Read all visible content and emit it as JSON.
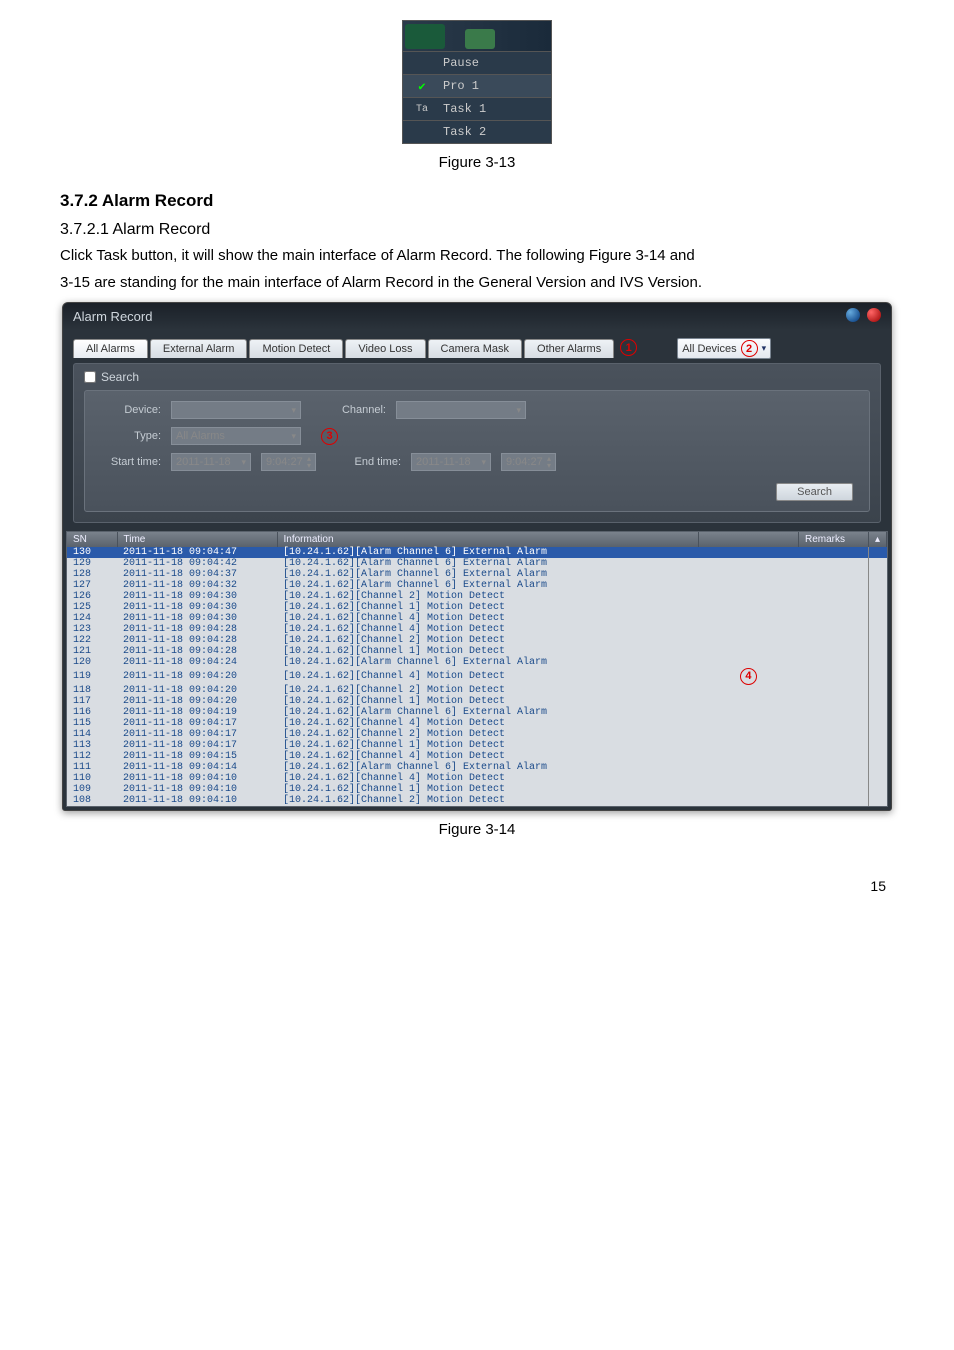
{
  "fig1": {
    "menu": [
      "Pause",
      "Pro 1",
      "Task 1",
      "Task 2"
    ],
    "ta_label": "Ta",
    "caption": "Figure 3-13"
  },
  "section": {
    "h3": "3.7.2  Alarm Record",
    "h4": "3.7.2.1  Alarm Record",
    "p1": "Click Task button, it will show the main interface of Alarm Record. The following Figure 3-14 and",
    "p2": "3-15 are standing for the main interface of Alarm Record in the General Version and IVS Version."
  },
  "alarm": {
    "title": "Alarm Record",
    "tabs": [
      "All Alarms",
      "External Alarm",
      "Motion Detect",
      "Video Loss",
      "Camera Mask",
      "Other Alarms"
    ],
    "device_dd": "All Devices",
    "circles": {
      "c1": "1",
      "c2": "2",
      "c3": "3",
      "c4": "4"
    },
    "search": {
      "header": "Search",
      "labels": {
        "device": "Device:",
        "channel": "Channel:",
        "type": "Type:",
        "start": "Start time:",
        "end": "End time:"
      },
      "type_val": "All Alarms",
      "date_val": "2011-11-18",
      "time_val": "9:04:27",
      "btn": "Search"
    },
    "columns": {
      "sn": "SN",
      "time": "Time",
      "info": "Information",
      "remarks": "Remarks"
    },
    "rows": [
      {
        "sn": "130",
        "time": "2011-11-18 09:04:47",
        "info": "[10.24.1.62][Alarm Channel 6] External Alarm",
        "hl": true
      },
      {
        "sn": "129",
        "time": "2011-11-18 09:04:42",
        "info": "[10.24.1.62][Alarm Channel 6] External Alarm"
      },
      {
        "sn": "128",
        "time": "2011-11-18 09:04:37",
        "info": "[10.24.1.62][Alarm Channel 6] External Alarm"
      },
      {
        "sn": "127",
        "time": "2011-11-18 09:04:32",
        "info": "[10.24.1.62][Alarm Channel 6] External Alarm"
      },
      {
        "sn": "126",
        "time": "2011-11-18 09:04:30",
        "info": "[10.24.1.62][Channel 2] Motion Detect"
      },
      {
        "sn": "125",
        "time": "2011-11-18 09:04:30",
        "info": "[10.24.1.62][Channel 1] Motion Detect"
      },
      {
        "sn": "124",
        "time": "2011-11-18 09:04:30",
        "info": "[10.24.1.62][Channel 4] Motion Detect"
      },
      {
        "sn": "123",
        "time": "2011-11-18 09:04:28",
        "info": "[10.24.1.62][Channel 4] Motion Detect"
      },
      {
        "sn": "122",
        "time": "2011-11-18 09:04:28",
        "info": "[10.24.1.62][Channel 2] Motion Detect"
      },
      {
        "sn": "121",
        "time": "2011-11-18 09:04:28",
        "info": "[10.24.1.62][Channel 1] Motion Detect"
      },
      {
        "sn": "120",
        "time": "2011-11-18 09:04:24",
        "info": "[10.24.1.62][Alarm Channel 6] External Alarm"
      },
      {
        "sn": "119",
        "time": "2011-11-18 09:04:20",
        "info": "[10.24.1.62][Channel 4] Motion Detect"
      },
      {
        "sn": "118",
        "time": "2011-11-18 09:04:20",
        "info": "[10.24.1.62][Channel 2] Motion Detect"
      },
      {
        "sn": "117",
        "time": "2011-11-18 09:04:20",
        "info": "[10.24.1.62][Channel 1] Motion Detect"
      },
      {
        "sn": "116",
        "time": "2011-11-18 09:04:19",
        "info": "[10.24.1.62][Alarm Channel 6] External Alarm"
      },
      {
        "sn": "115",
        "time": "2011-11-18 09:04:17",
        "info": "[10.24.1.62][Channel 4] Motion Detect"
      },
      {
        "sn": "114",
        "time": "2011-11-18 09:04:17",
        "info": "[10.24.1.62][Channel 2] Motion Detect"
      },
      {
        "sn": "113",
        "time": "2011-11-18 09:04:17",
        "info": "[10.24.1.62][Channel 1] Motion Detect"
      },
      {
        "sn": "112",
        "time": "2011-11-18 09:04:15",
        "info": "[10.24.1.62][Channel 4] Motion Detect"
      },
      {
        "sn": "111",
        "time": "2011-11-18 09:04:14",
        "info": "[10.24.1.62][Alarm Channel 6] External Alarm"
      },
      {
        "sn": "110",
        "time": "2011-11-18 09:04:10",
        "info": "[10.24.1.62][Channel 4] Motion Detect"
      },
      {
        "sn": "109",
        "time": "2011-11-18 09:04:10",
        "info": "[10.24.1.62][Channel 1] Motion Detect"
      },
      {
        "sn": "108",
        "time": "2011-11-18 09:04:10",
        "info": "[10.24.1.62][Channel 2] Motion Detect"
      }
    ]
  },
  "fig14_caption": "Figure 3-14",
  "page_num": "15"
}
